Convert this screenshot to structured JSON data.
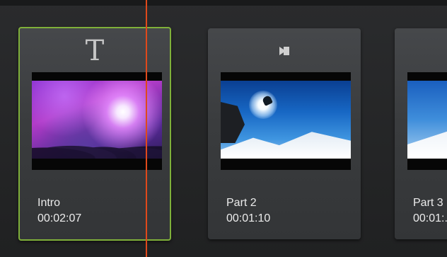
{
  "clips": [
    {
      "icon": "title-icon",
      "icon_glyph": "T",
      "name": "Intro",
      "duration": "00:02:07",
      "selected": true
    },
    {
      "icon": "audio-muted-icon",
      "name": "Part 2",
      "duration": "00:01:10",
      "selected": false
    },
    {
      "icon": "audio-muted-icon",
      "name": "Part 3",
      "duration": "00:01:..",
      "selected": false
    }
  ],
  "colors": {
    "selection_border": "#7fb03a",
    "playhead": "#e0491b",
    "background": "#232425",
    "clip_card": "#3d3f42"
  }
}
